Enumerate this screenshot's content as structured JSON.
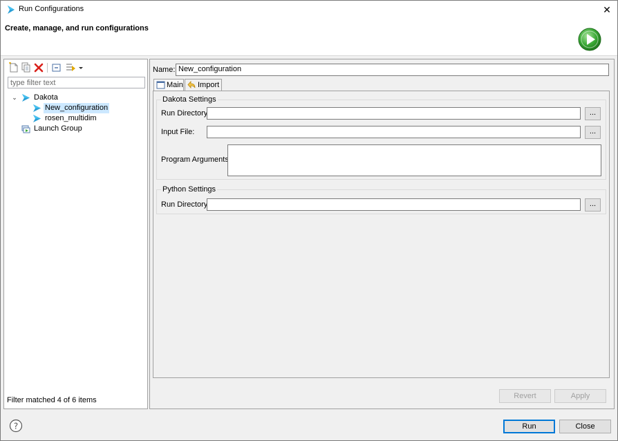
{
  "window": {
    "title": "Run Configurations",
    "close_glyph": "✕"
  },
  "banner": {
    "title": "Create, manage, and run configurations",
    "icon": "run-play-icon"
  },
  "left_toolbar": {
    "icons": [
      "new-configuration-icon",
      "duplicate-icon",
      "delete-icon",
      "collapse-all-icon",
      "filter-icon",
      "dropdown-arrow-icon"
    ]
  },
  "filter": {
    "placeholder": "type filter text",
    "value": ""
  },
  "tree": {
    "items": [
      {
        "label": "Dakota",
        "expanded_glyph": "⌄",
        "icon": "dakota-icon"
      },
      {
        "label": "New_configuration",
        "icon": "dakota-config-icon",
        "selected": true
      },
      {
        "label": "rosen_multidim",
        "icon": "dakota-config-icon"
      },
      {
        "label": "Launch Group",
        "icon": "launch-group-icon"
      }
    ]
  },
  "status": {
    "filter_matched": "Filter matched 4 of 6 items"
  },
  "config": {
    "name_label": "Name:",
    "name_value": "New_configuration",
    "tabs": [
      {
        "label": "Main",
        "icon": "main-tab-icon",
        "active": true
      },
      {
        "label": "Import",
        "icon": "import-tab-icon",
        "active": false
      }
    ],
    "dakota_settings": {
      "title": "Dakota Settings",
      "run_directory_label": "Run Directory:",
      "run_directory_value": "",
      "input_file_label": "Input File:",
      "input_file_value": "",
      "program_arguments_label": "Program Arguments:",
      "program_arguments_value": "",
      "browse_label": "..."
    },
    "python_settings": {
      "title": "Python Settings",
      "run_directory_label": "Run Directory:",
      "run_directory_value": "",
      "browse_label": "..."
    }
  },
  "buttons": {
    "revert": "Revert",
    "apply": "Apply",
    "run": "Run",
    "close": "Close"
  },
  "help": {
    "icon": "help-icon",
    "glyph": "?"
  },
  "colors": {
    "selection": "#cce8ff",
    "accent": "#0078d7",
    "run_green": "#3aa935"
  }
}
